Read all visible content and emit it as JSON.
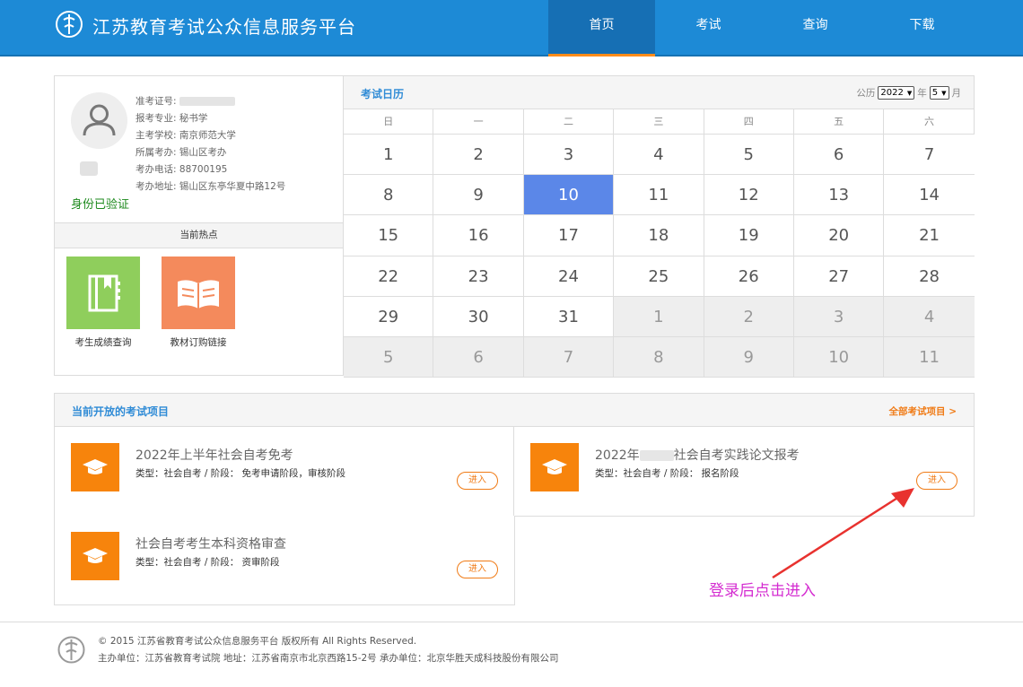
{
  "header": {
    "site_title": "江苏教育考试公众信息服务平台",
    "nav": [
      "首页",
      "考试",
      "查询",
      "下载"
    ]
  },
  "profile": {
    "rows": [
      {
        "label": "准考证号:",
        "value": ""
      },
      {
        "label": "报考专业:",
        "value": "秘书学"
      },
      {
        "label": "主考学校:",
        "value": "南京师范大学"
      },
      {
        "label": "所属考办:",
        "value": "锡山区考办"
      },
      {
        "label": "考办电话:",
        "value": "88700195"
      },
      {
        "label": "考办地址:",
        "value": "锡山区东亭华夏中路12号"
      }
    ],
    "verified": "身份已验证",
    "hot_title": "当前热点",
    "hot_items": [
      {
        "label": "考生成绩查询",
        "color": "#8fce5c"
      },
      {
        "label": "教材订购链接",
        "color": "#f48a5c"
      }
    ]
  },
  "calendar": {
    "title": "考试日历",
    "calendar_label": "公历",
    "year": "2022",
    "year_unit": "年",
    "month": "5",
    "month_unit": "月",
    "weekdays": [
      "日",
      "一",
      "二",
      "三",
      "四",
      "五",
      "六"
    ],
    "weeks": [
      [
        "1",
        "2",
        "3",
        "4",
        "5",
        "6",
        "7"
      ],
      [
        "8",
        "9",
        "10",
        "11",
        "12",
        "13",
        "14"
      ],
      [
        "15",
        "16",
        "17",
        "18",
        "19",
        "20",
        "21"
      ],
      [
        "22",
        "23",
        "24",
        "25",
        "26",
        "27",
        "28"
      ],
      [
        "29",
        "30",
        "31",
        "1",
        "2",
        "3",
        "4"
      ],
      [
        "5",
        "6",
        "7",
        "8",
        "9",
        "10",
        "11"
      ]
    ],
    "today": "10",
    "accent": "#5b87e8"
  },
  "exams": {
    "title": "当前开放的考试项目",
    "all_link": "全部考试项目 >",
    "enter_label": "进入",
    "items": [
      {
        "name": "2022年上半年社会自考免考",
        "meta": "类型：社会自考 / 阶段：  免考申请阶段，审核阶段"
      },
      {
        "name_prefix": "2022年",
        "name_suffix": "社会自考实践论文报考",
        "meta": "类型：社会自考 / 阶段：  报名阶段"
      },
      {
        "name": "社会自考考生本科资格审查",
        "meta": "类型：社会自考 / 阶段：  资审阶段"
      }
    ]
  },
  "annotation": "登录后点击进入",
  "footer": {
    "line1": "© 2015 江苏省教育考试公众信息服务平台 版权所有 All Rights Reserved.",
    "line2": "主办单位：江苏省教育考试院 地址：江苏省南京市北京西路15-2号 承办单位：北京华胜天成科技股份有限公司"
  }
}
